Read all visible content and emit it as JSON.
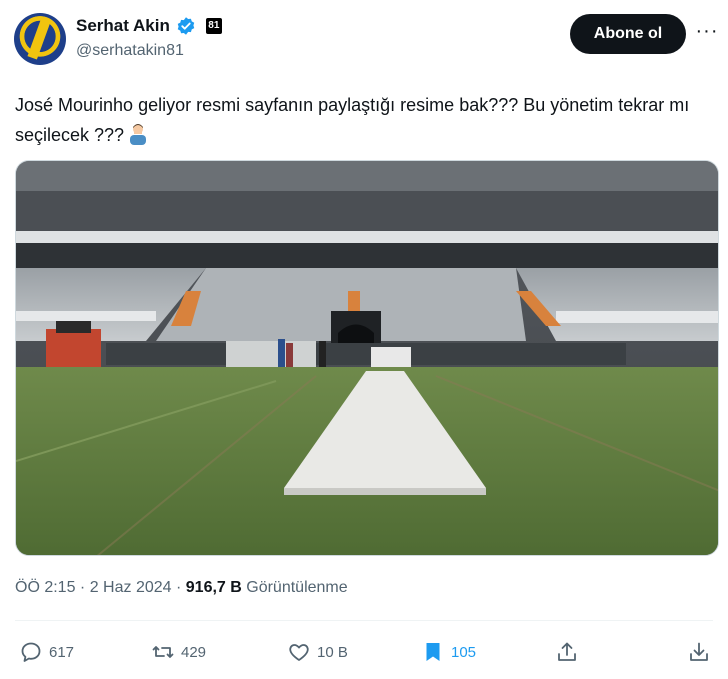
{
  "author": {
    "display_name": "Serhat Akin",
    "handle": "@serhatakin81",
    "badge": "81",
    "verified_icon": "verified-badge-icon"
  },
  "follow_button_label": "Abone ol",
  "more_label": "···",
  "tweet": {
    "text": "José Mourinho geliyor resmi sayfanın paylaştığı resime bak??? Bu yönetim tekrar mı seçilecek ???",
    "emoji": "person-facepalm-emoji"
  },
  "meta": {
    "time": "ÖÖ 2:15",
    "sep1": " · ",
    "date": "2 Haz 2024",
    "sep2": " · ",
    "views_count": "916,7 B",
    "views_label": " Görüntülenme"
  },
  "actions": {
    "replies": "617",
    "retweets": "429",
    "likes": "10 B",
    "bookmarks": "105"
  },
  "colors": {
    "accent": "#1d9bf0",
    "text_primary": "#0f1419",
    "text_secondary": "#536471",
    "button_dark": "#0f1419",
    "pitch_green": "#5f7a3f"
  }
}
